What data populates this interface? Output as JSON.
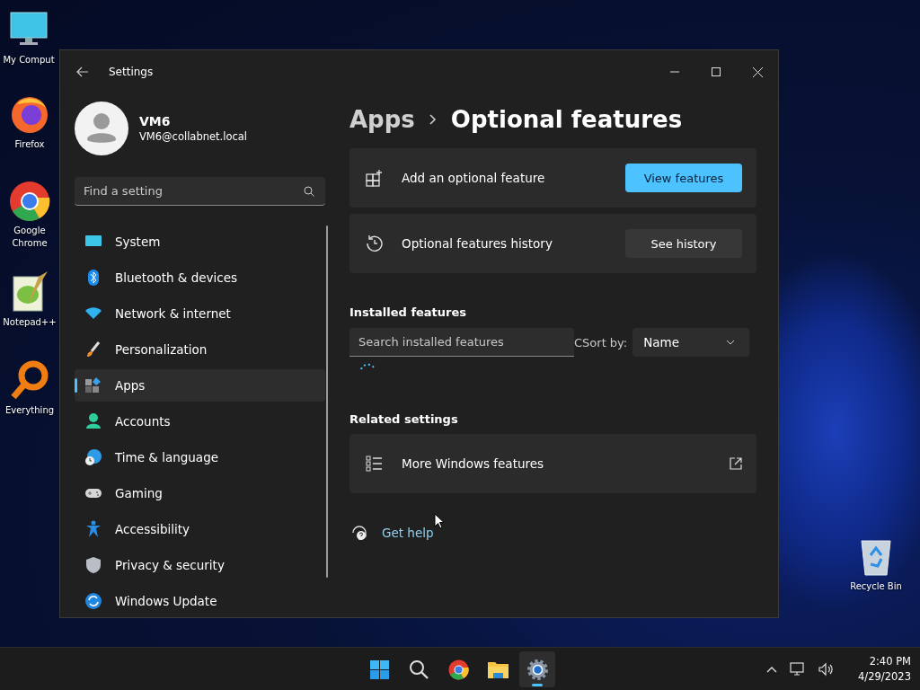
{
  "desktop_icons": [
    {
      "label": "My Comput"
    },
    {
      "label": "Firefox"
    },
    {
      "label": "Google Chrome"
    },
    {
      "label": "Notepad++"
    },
    {
      "label": "Everything"
    }
  ],
  "recycle_bin": {
    "label": "Recycle Bin"
  },
  "window": {
    "title": "Settings",
    "profile": {
      "name": "VM6",
      "email": "VM6@collabnet.local"
    },
    "search": {
      "placeholder": "Find a setting"
    },
    "nav": [
      {
        "label": "System",
        "selected": false
      },
      {
        "label": "Bluetooth & devices",
        "selected": false
      },
      {
        "label": "Network & internet",
        "selected": false
      },
      {
        "label": "Personalization",
        "selected": false
      },
      {
        "label": "Apps",
        "selected": true
      },
      {
        "label": "Accounts",
        "selected": false
      },
      {
        "label": "Time & language",
        "selected": false
      },
      {
        "label": "Gaming",
        "selected": false
      },
      {
        "label": "Accessibility",
        "selected": false
      },
      {
        "label": "Privacy & security",
        "selected": false
      },
      {
        "label": "Windows Update",
        "selected": false
      }
    ],
    "breadcrumb": {
      "parent": "Apps",
      "current": "Optional features"
    },
    "cards": [
      {
        "kind": "add",
        "label": "Add an optional feature",
        "button": {
          "label": "View features",
          "primary": true
        }
      },
      {
        "kind": "history",
        "label": "Optional features history",
        "button": {
          "label": "See history",
          "primary": false
        }
      }
    ],
    "installed": {
      "heading": "Installed features",
      "search": {
        "placeholder": "Search installed features"
      },
      "sort_label": "CSort by:",
      "sort_value": "Name"
    },
    "related": {
      "heading": "Related settings",
      "items": [
        {
          "label": "More Windows features"
        }
      ]
    },
    "help_link": "Get help"
  },
  "taskbar": {
    "apps": [
      {
        "kind": "start",
        "selected": false
      },
      {
        "kind": "search",
        "selected": false
      },
      {
        "kind": "chrome",
        "selected": false
      },
      {
        "kind": "explorer",
        "selected": false
      },
      {
        "kind": "settings",
        "selected": true
      }
    ],
    "clock": {
      "time": "2:40 PM",
      "date": "4/29/2023"
    }
  }
}
